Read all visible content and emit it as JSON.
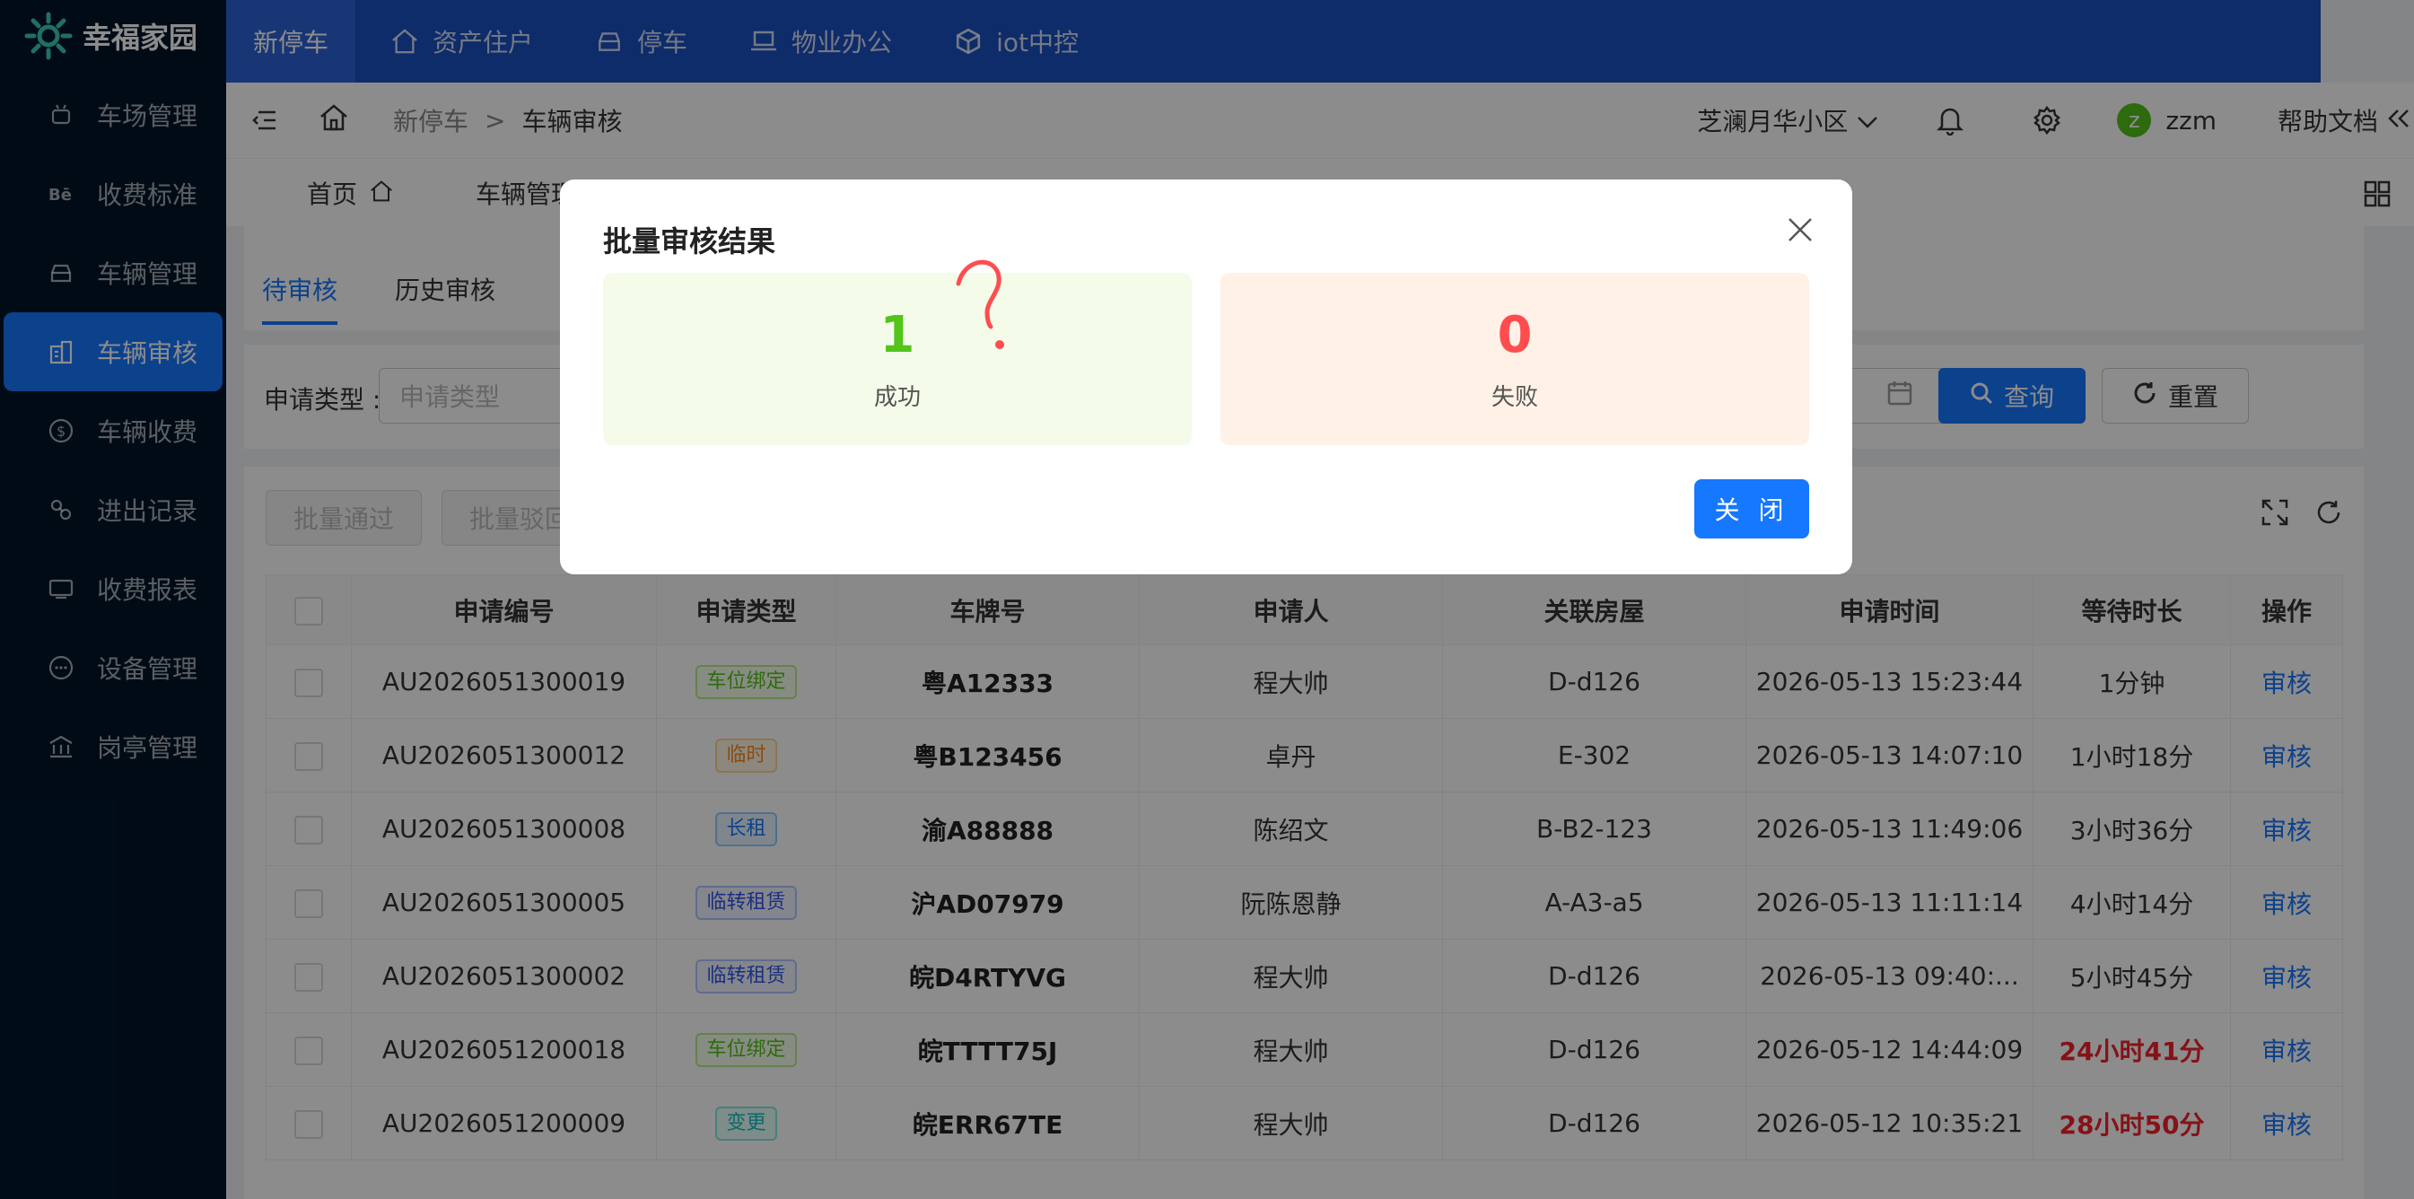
{
  "app": {
    "name": "幸福家园"
  },
  "sidebar": {
    "items": [
      {
        "label": "车场管理",
        "icon": "android-icon"
      },
      {
        "label": "收费标准",
        "icon": "behance-icon"
      },
      {
        "label": "车辆管理",
        "icon": "car-icon"
      },
      {
        "label": "车辆审核",
        "icon": "building-icon",
        "active": true
      },
      {
        "label": "车辆收费",
        "icon": "dollar-icon"
      },
      {
        "label": "进出记录",
        "icon": "link-icon"
      },
      {
        "label": "收费报表",
        "icon": "report-icon"
      },
      {
        "label": "设备管理",
        "icon": "message-icon"
      },
      {
        "label": "岗亭管理",
        "icon": "bank-icon"
      }
    ]
  },
  "topnav": {
    "tabs": [
      {
        "label": "新停车",
        "active": true
      },
      {
        "label": "资产住户",
        "icon": "home-icon"
      },
      {
        "label": "停车",
        "icon": "car-icon"
      },
      {
        "label": "物业办公",
        "icon": "laptop-icon"
      },
      {
        "label": "iot中控",
        "icon": "cube-icon"
      }
    ]
  },
  "header": {
    "breadcrumb": [
      "新停车",
      "车辆审核"
    ],
    "separator": ">",
    "community": "芝澜月华小区",
    "user": {
      "initial": "z",
      "name": "zzm"
    },
    "help": "帮助文档"
  },
  "pagetabs": {
    "home": "首页",
    "vehicle_manage": "车辆管理"
  },
  "subtabs": {
    "pending": "待审核",
    "history": "历史审核"
  },
  "filter": {
    "type_label": "申请类型 :",
    "type_placeholder": "申请类型",
    "query": "查询",
    "reset": "重置"
  },
  "toolbar": {
    "batch_pass": "批量通过",
    "batch_reject": "批量驳回"
  },
  "table": {
    "columns": [
      "申请编号",
      "申请类型",
      "车牌号",
      "申请人",
      "关联房屋",
      "申请时间",
      "等待时长",
      "操作"
    ],
    "rows": [
      {
        "id": "AU2026051300019",
        "type": "车位绑定",
        "tag": "green",
        "plate": "粤A12333",
        "applicant": "程大帅",
        "house": "D-d126",
        "time": "2026-05-13 15:23:44",
        "wait": "1分钟",
        "urgent": false,
        "action": "审核"
      },
      {
        "id": "AU2026051300012",
        "type": "临时",
        "tag": "orange",
        "plate": "粤B123456",
        "applicant": "卓丹",
        "house": "E-302",
        "time": "2026-05-13 14:07:10",
        "wait": "1小时18分",
        "urgent": false,
        "action": "审核"
      },
      {
        "id": "AU2026051300008",
        "type": "长租",
        "tag": "blue",
        "plate": "渝A88888",
        "applicant": "陈绍文",
        "house": "B-B2-123",
        "time": "2026-05-13 11:49:06",
        "wait": "3小时36分",
        "urgent": false,
        "action": "审核"
      },
      {
        "id": "AU2026051300005",
        "type": "临转租赁",
        "tag": "purple",
        "plate": "沪AD07979",
        "applicant": "阮陈恩静",
        "house": "A-A3-a5",
        "time": "2026-05-13 11:11:14",
        "wait": "4小时14分",
        "urgent": false,
        "action": "审核"
      },
      {
        "id": "AU2026051300002",
        "type": "临转租赁",
        "tag": "purple",
        "plate": "皖D4RTYVG",
        "applicant": "程大帅",
        "house": "D-d126",
        "time": "2026-05-13 09:40:...",
        "wait": "5小时45分",
        "urgent": false,
        "action": "审核"
      },
      {
        "id": "AU2026051200018",
        "type": "车位绑定",
        "tag": "green",
        "plate": "皖TTTT75J",
        "applicant": "程大帅",
        "house": "D-d126",
        "time": "2026-05-12 14:44:09",
        "wait": "24小时41分",
        "urgent": true,
        "action": "审核"
      },
      {
        "id": "AU2026051200009",
        "type": "变更",
        "tag": "cyan",
        "plate": "皖ERR67TE",
        "applicant": "程大帅",
        "house": "D-d126",
        "time": "2026-05-12 10:35:21",
        "wait": "28小时50分",
        "urgent": true,
        "action": "审核"
      }
    ]
  },
  "modal": {
    "title": "批量审核结果",
    "success_count": "1",
    "success_label": "成功",
    "fail_count": "0",
    "fail_label": "失败",
    "close": "关 闭"
  },
  "colors": {
    "primary": "#1677ff",
    "sidebar": "#001529",
    "topbar": "#1b4fc2",
    "success": "#52c41a",
    "danger": "#ff4d4f"
  }
}
